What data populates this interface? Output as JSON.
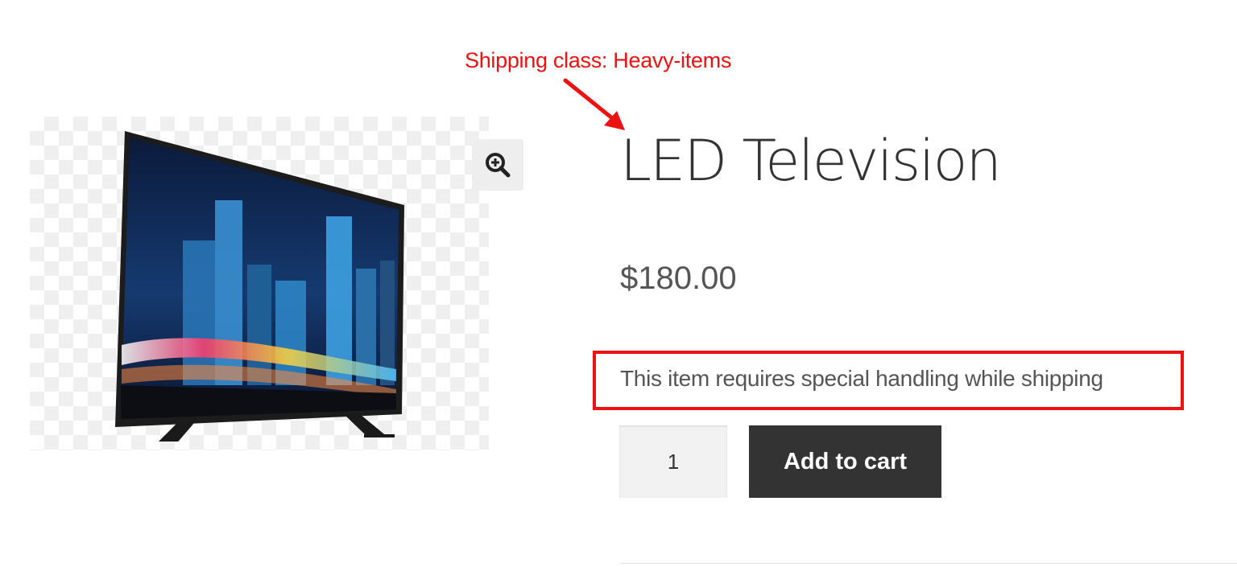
{
  "annotation": {
    "label": "Shipping class: Heavy-items",
    "color": "#ee1111"
  },
  "gallery": {
    "zoom_icon": "zoom-in-icon",
    "image_subject": "LED television"
  },
  "product": {
    "title": "LED Television",
    "price": "$180.00",
    "shipping_notice": "This item requires special handling while shipping",
    "quantity": "1",
    "add_to_cart_label": "Add to cart"
  },
  "colors": {
    "button_bg": "#333333",
    "highlight_border": "#ee1111",
    "text": "#555555"
  }
}
